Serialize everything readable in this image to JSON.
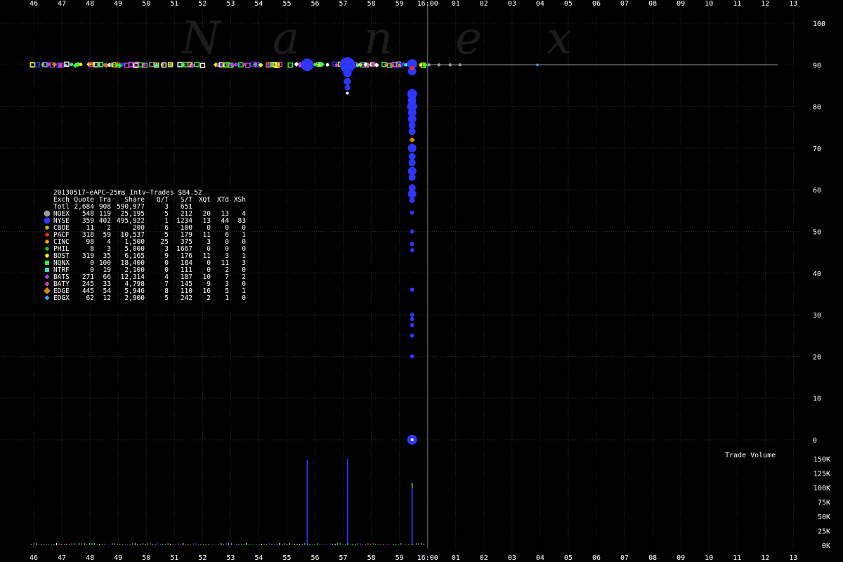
{
  "chart_data": {
    "type": "scatter",
    "title": "20130517~eAPC~25ms Intv~Trades $84.52",
    "watermark": "Nanex",
    "x_ticks_top": [
      "46",
      "47",
      "48",
      "49",
      "50",
      "51",
      "52",
      "53",
      "54",
      "55",
      "56",
      "57",
      "58",
      "59",
      "16:00",
      "01",
      "02",
      "03",
      "04",
      "05",
      "06",
      "07",
      "08",
      "09",
      "10",
      "11",
      "12",
      "13"
    ],
    "x_ticks_bottom": [
      "46",
      "47",
      "48",
      "49",
      "50",
      "51",
      "52",
      "53",
      "54",
      "55",
      "56",
      "57",
      "58",
      "59",
      "16:00",
      "01",
      "02",
      "03",
      "04",
      "05",
      "06",
      "07",
      "08",
      "09",
      "10",
      "11",
      "12",
      "13"
    ],
    "price_ticks": [
      100,
      90,
      80,
      70,
      60,
      50,
      40,
      30,
      20,
      10,
      0
    ],
    "price_ylim": [
      0,
      100
    ],
    "volume_label": "Trade Volume",
    "volume_ticks": [
      "150K",
      "125K",
      "100K",
      "75K",
      "50K",
      "25K",
      "0K"
    ],
    "volume_ylim": [
      0,
      150000
    ],
    "table": {
      "headers": [
        "Exch",
        "Quote",
        "Tra",
        "Share",
        "Q/T",
        "S/T",
        "XQt",
        "XTd",
        "XSh"
      ],
      "rows": [
        {
          "exch": "Totl",
          "quote": "2,684",
          "tra": "908",
          "share": "590,977",
          "qt": "3",
          "st": "651",
          "xqt": "",
          "xtd": "",
          "xsh": "",
          "color": ""
        },
        {
          "exch": "NQEX",
          "quote": "548",
          "tra": "119",
          "share": "25,195",
          "qt": "5",
          "st": "212",
          "xqt": "20",
          "xtd": "13",
          "xsh": "4",
          "color": "#9a9a9a"
        },
        {
          "exch": "NYSE",
          "quote": "359",
          "tra": "402",
          "share": "495,922",
          "qt": "1",
          "st": "1234",
          "xqt": "13",
          "xtd": "44",
          "xsh": "83",
          "color": "#2f36ff"
        },
        {
          "exch": "CBOE",
          "quote": "11",
          "tra": "2",
          "share": "200",
          "qt": "6",
          "st": "100",
          "xqt": "0",
          "xtd": "0",
          "xsh": "0",
          "color": "#c8b400"
        },
        {
          "exch": "PACF",
          "quote": "318",
          "tra": "59",
          "share": "10,537",
          "qt": "5",
          "st": "179",
          "xqt": "11",
          "xtd": "6",
          "xsh": "1",
          "color": "#ff2020"
        },
        {
          "exch": "CINC",
          "quote": "98",
          "tra": "4",
          "share": "1,500",
          "qt": "25",
          "st": "375",
          "xqt": "3",
          "xtd": "0",
          "xsh": "0",
          "color": "#ff9a00"
        },
        {
          "exch": "PHIL",
          "quote": "8",
          "tra": "3",
          "share": "5,000",
          "qt": "3",
          "st": "1667",
          "xqt": "0",
          "xtd": "0",
          "xsh": "0",
          "color": "#20c020"
        },
        {
          "exch": "BOST",
          "quote": "319",
          "tra": "35",
          "share": "6,165",
          "qt": "9",
          "st": "176",
          "xqt": "11",
          "xtd": "3",
          "xsh": "1",
          "color": "#e8ff00"
        },
        {
          "exch": "NQNX",
          "quote": "0",
          "tra": "100",
          "share": "18,400",
          "qt": "0",
          "st": "184",
          "xqt": "0",
          "xtd": "11",
          "xsh": "3",
          "color": "#30ff30"
        },
        {
          "exch": "NTRF",
          "quote": "0",
          "tra": "19",
          "share": "2,100",
          "qt": "0",
          "st": "111",
          "xqt": "0",
          "xtd": "2",
          "xsh": "0",
          "color": "#40e0c0"
        },
        {
          "exch": "BATS",
          "quote": "271",
          "tra": "66",
          "share": "12,314",
          "qt": "4",
          "st": "187",
          "xqt": "10",
          "xtd": "7",
          "xsh": "2",
          "color": "#b040e0"
        },
        {
          "exch": "BATY",
          "quote": "245",
          "tra": "33",
          "share": "4,798",
          "qt": "7",
          "st": "145",
          "xqt": "9",
          "xtd": "3",
          "xsh": "0",
          "color": "#e040c0"
        },
        {
          "exch": "EDGE",
          "quote": "445",
          "tra": "54",
          "share": "5,946",
          "qt": "8",
          "st": "110",
          "xqt": "16",
          "xtd": "5",
          "xsh": "1",
          "color": "#d08a00"
        },
        {
          "exch": "EDGX",
          "quote": "62",
          "tra": "12",
          "share": "2,900",
          "qt": "5",
          "st": "242",
          "xqt": "2",
          "xtd": "1",
          "xsh": "0",
          "color": "#40a0ff"
        }
      ]
    },
    "marker_colors": [
      "#30ff30",
      "#d08a00",
      "#b040e0",
      "#e040c0",
      "#ffffff",
      "#2f36ff",
      "#40e0c0",
      "#e8ff00",
      "#9a9a9a"
    ],
    "trades": [
      {
        "x": 55.72,
        "y": 90,
        "r": 9,
        "color": "#2f36ff"
      },
      {
        "x": 57.15,
        "y": 90,
        "r": 11,
        "color": "#2f36ff"
      },
      {
        "x": 57.15,
        "y": 88,
        "r": 6,
        "color": "#2f36ff"
      },
      {
        "x": 57.15,
        "y": 86,
        "r": 5,
        "color": "#2f36ff"
      },
      {
        "x": 57.15,
        "y": 84.5,
        "r": 4,
        "color": "#2f36ff"
      },
      {
        "x": 57.15,
        "y": 83.2,
        "r": 2,
        "color": "#ffffff"
      },
      {
        "x": 59.45,
        "y": 90.2,
        "r": 7,
        "color": "#2f36ff"
      },
      {
        "x": 59.45,
        "y": 88.5,
        "r": 6,
        "color": "#2f36ff"
      },
      {
        "x": 59.45,
        "y": 83,
        "r": 7,
        "color": "#2f36ff"
      },
      {
        "x": 59.45,
        "y": 81.5,
        "r": 6,
        "color": "#2f36ff"
      },
      {
        "x": 59.45,
        "y": 80,
        "r": 7,
        "color": "#2f36ff"
      },
      {
        "x": 59.45,
        "y": 78.5,
        "r": 6,
        "color": "#2f36ff"
      },
      {
        "x": 59.45,
        "y": 77,
        "r": 6,
        "color": "#2f36ff"
      },
      {
        "x": 59.45,
        "y": 75.5,
        "r": 5,
        "color": "#2f36ff"
      },
      {
        "x": 59.45,
        "y": 74,
        "r": 5,
        "color": "#2f36ff"
      },
      {
        "x": 59.45,
        "y": 72,
        "r": 4,
        "color": "#d08a00"
      },
      {
        "x": 59.45,
        "y": 70,
        "r": 6,
        "color": "#2f36ff"
      },
      {
        "x": 59.45,
        "y": 68,
        "r": 5,
        "color": "#2f36ff"
      },
      {
        "x": 59.45,
        "y": 66.5,
        "r": 5,
        "color": "#2f36ff"
      },
      {
        "x": 59.45,
        "y": 64.5,
        "r": 6,
        "color": "#2f36ff"
      },
      {
        "x": 59.45,
        "y": 63,
        "r": 5,
        "color": "#2f36ff"
      },
      {
        "x": 59.45,
        "y": 60.5,
        "r": 5,
        "color": "#2f36ff"
      },
      {
        "x": 59.45,
        "y": 59,
        "r": 6,
        "color": "#2f36ff"
      },
      {
        "x": 59.45,
        "y": 57.5,
        "r": 4,
        "color": "#2f36ff"
      },
      {
        "x": 59.45,
        "y": 54.5,
        "r": 3,
        "color": "#2f36ff"
      },
      {
        "x": 59.45,
        "y": 50,
        "r": 3,
        "color": "#2f36ff"
      },
      {
        "x": 59.45,
        "y": 47,
        "r": 3,
        "color": "#2f36ff"
      },
      {
        "x": 59.45,
        "y": 45.5,
        "r": 3,
        "color": "#2f36ff"
      },
      {
        "x": 59.45,
        "y": 36,
        "r": 3,
        "color": "#2f36ff"
      },
      {
        "x": 59.45,
        "y": 30,
        "r": 3,
        "color": "#2f36ff"
      },
      {
        "x": 59.45,
        "y": 29,
        "r": 3,
        "color": "#2f36ff"
      },
      {
        "x": 59.45,
        "y": 27.5,
        "r": 3,
        "color": "#2f36ff"
      },
      {
        "x": 59.45,
        "y": 25,
        "r": 3,
        "color": "#2f36ff"
      },
      {
        "x": 59.45,
        "y": 20,
        "r": 3,
        "color": "#2f36ff"
      },
      {
        "x": 59.45,
        "y": 0.0,
        "r": 7,
        "color": "#2f36ff"
      },
      {
        "x": 59.45,
        "y": 0.0,
        "r": 2,
        "color": "#ffffff"
      },
      {
        "x": 59.45,
        "y": 89.2,
        "r": 3,
        "color": "#ff2020"
      }
    ],
    "nbbo_line": {
      "x_start": 59.8,
      "x_end": 72.45,
      "y": 90,
      "color": "#707070"
    },
    "volume_bars": [
      {
        "x": 55.72,
        "value": 148000,
        "color": "#2f36ff"
      },
      {
        "x": 57.15,
        "value": 150000,
        "color": "#2f36ff"
      },
      {
        "x": 59.45,
        "value": 108000,
        "color": "#30ff30"
      },
      {
        "x": 59.45,
        "value": 100000,
        "color": "#2f36ff"
      }
    ],
    "current_time_x": 60.0
  }
}
